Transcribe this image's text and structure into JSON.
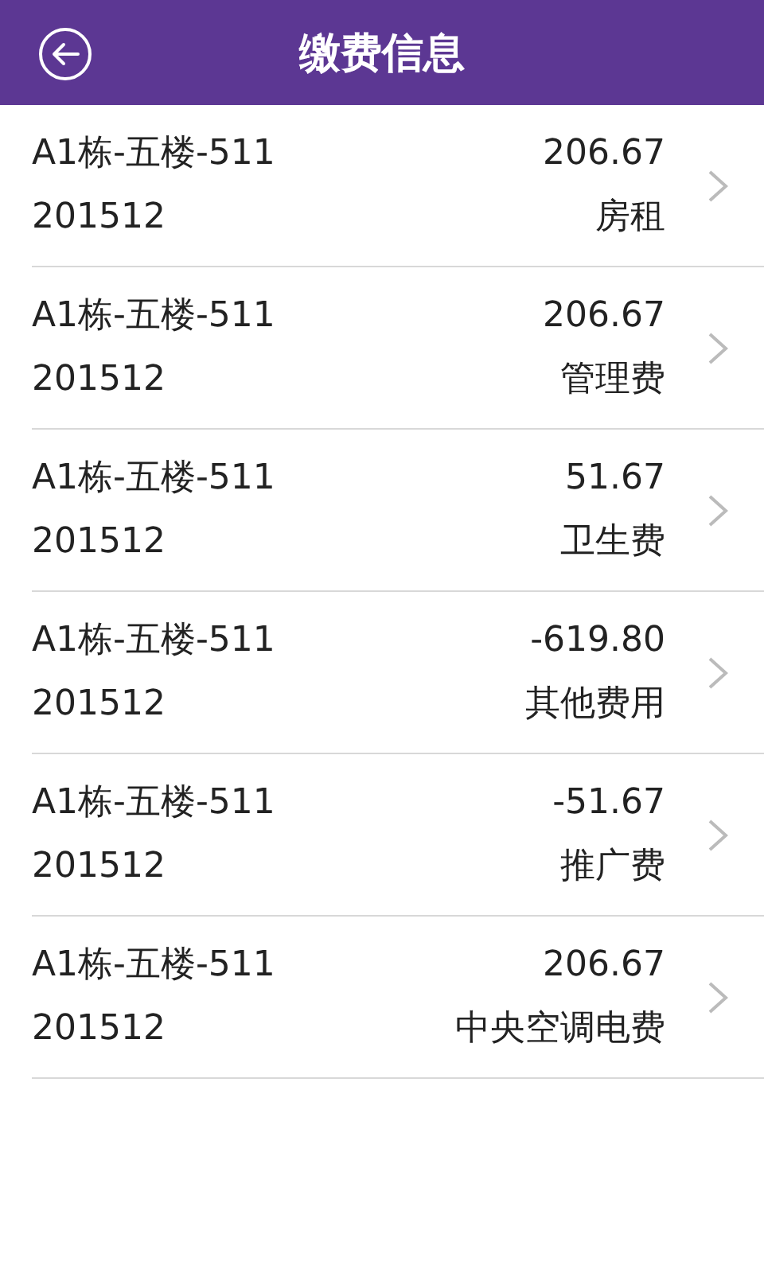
{
  "header": {
    "title": "缴费信息"
  },
  "payments": [
    {
      "unit": "A1栋-五楼-511",
      "amount": "206.67",
      "period": "201512",
      "fee_type": "房租"
    },
    {
      "unit": "A1栋-五楼-511",
      "amount": "206.67",
      "period": "201512",
      "fee_type": "管理费"
    },
    {
      "unit": "A1栋-五楼-511",
      "amount": "51.67",
      "period": "201512",
      "fee_type": "卫生费"
    },
    {
      "unit": "A1栋-五楼-511",
      "amount": "-619.80",
      "period": "201512",
      "fee_type": "其他费用"
    },
    {
      "unit": "A1栋-五楼-511",
      "amount": "-51.67",
      "period": "201512",
      "fee_type": "推广费"
    },
    {
      "unit": "A1栋-五楼-511",
      "amount": "206.67",
      "period": "201512",
      "fee_type": "中央空调电费"
    }
  ]
}
